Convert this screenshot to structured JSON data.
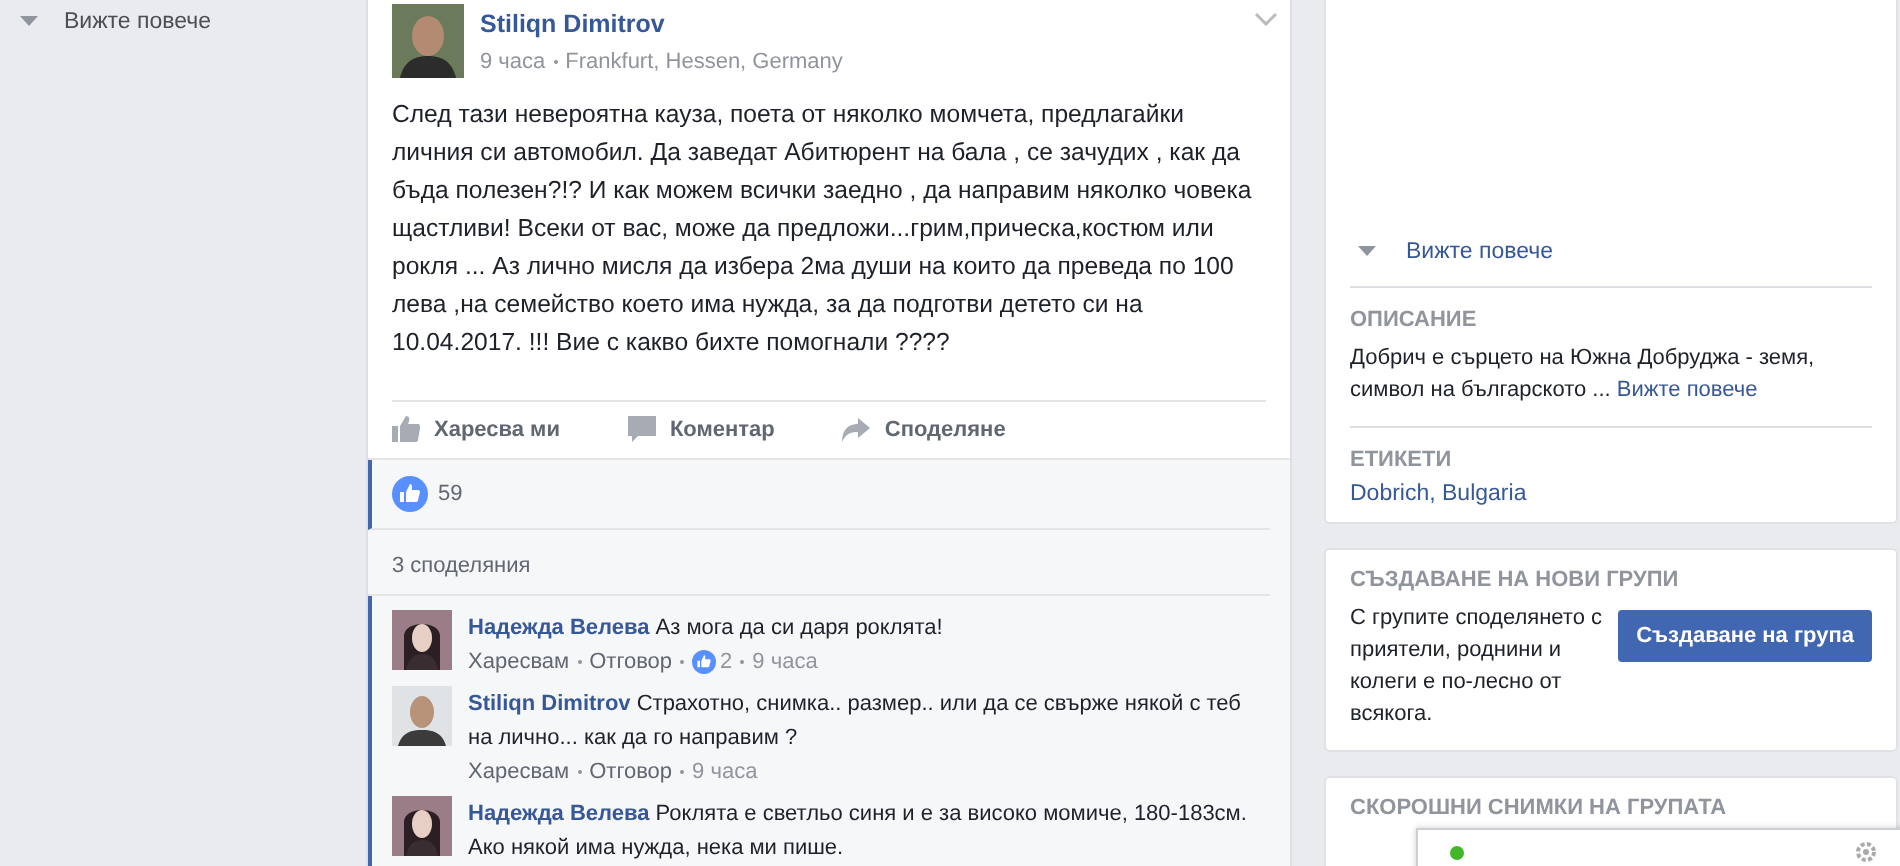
{
  "left_sidebar": {
    "see_more": "Вижте повече"
  },
  "post": {
    "author": "Stiliqn Dimitrov",
    "time": "9 часа",
    "location": "Frankfurt, Hessen, Germany",
    "text": "След тази невероятна кауза, поета от няколко момчета, предлагайки личния си автомобил. Да заведат Абитюрент на бала , се зачудих , как да бъда полезен?!? И как можем всички заедно , да направим няколко човека щастливи! Всеки от вас, може да предложи...грим,прическа,костюм или рокля ... Аз лично мисля да избера 2ма души на които да преведа по 100 лева ,на семейство което има нужда, за да подготви детето си на 10.04.2017. !!! Вие с какво бихте помогнали ????",
    "actions": [
      {
        "kind": "like",
        "label": "Харесва ми"
      },
      {
        "kind": "comment",
        "label": "Коментар"
      },
      {
        "kind": "share",
        "label": "Споделяне"
      }
    ],
    "likes": "59",
    "shares": "3 споделяния",
    "comments": [
      {
        "author": "Надежда Велева",
        "kind": "woman",
        "text": "Аз мога да си даря роклята!",
        "like": "Харесвам",
        "reply": "Отговор",
        "likes": "2",
        "time": "9 часа"
      },
      {
        "author": "Stiliqn Dimitrov",
        "kind": "man",
        "text": "Страхотно, снимка.. размер.. или да се свърже някой с теб на лично... как да го направим ?",
        "like": "Харесвам",
        "reply": "Отговор",
        "time": "9 часа"
      },
      {
        "author": "Надежда Велева",
        "kind": "woman",
        "text": "Роклята е светльо синя и е за високо момиче, 180-183см. Ако някой има нужда, нека ми пише."
      }
    ]
  },
  "about": {
    "see_more": "Вижте повече",
    "description_heading": "ОПИСАНИЕ",
    "description": "Добрич е сърцето на Южна Добруджа - земя, символ на българското ...",
    "description_more": "Вижте повече",
    "tags_heading": "ЕТИКЕТИ",
    "tags": "Dobrich, Bulgaria"
  },
  "create_group": {
    "heading": "СЪЗДАВАНЕ НА НОВИ ГРУПИ",
    "text": "С групите споделянето с приятели, роднини и колеги е по-лесно от всякога.",
    "button": "Създаване на група"
  },
  "recent_photos": {
    "heading": "СКОРОШНИ СНИМКИ НА ГРУПАТА"
  },
  "chat_bar": {
    "online": true
  }
}
